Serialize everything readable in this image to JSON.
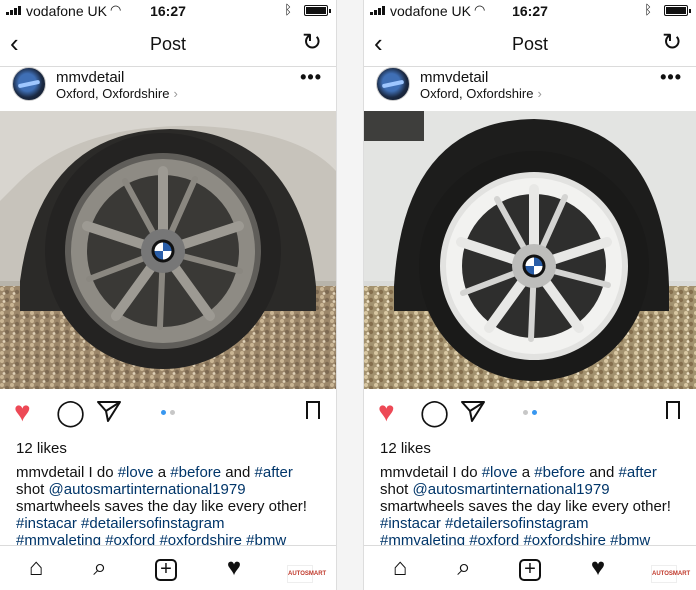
{
  "screens": [
    {
      "status": {
        "carrier": "vodafone UK",
        "time": "16:27"
      },
      "nav": {
        "title": "Post"
      },
      "post": {
        "username": "mmvdetail",
        "location": "Oxford, Oxfordshire",
        "likes": "12 likes",
        "caption_user": "mmvdetail",
        "caption_line1": " I do ",
        "tag_love": "#love",
        "caption_a": " a ",
        "tag_before": "#before",
        "caption_and": " and ",
        "tag_after": "#after",
        "caption_shot": "shot ",
        "mention": "@autosmartinternational1979",
        "caption_line3": "smartwheels saves the day like every other!",
        "tag_instacar": "#instacar",
        "tag_detailers": "#detailersofinstagram",
        "tag_mmvaleting": "#mmvaleting",
        "tag_oxford": "#oxford",
        "tag_oxfordshire": "#oxfordshire",
        "tag_bmw": "#bmw",
        "image": "dirty-wheel-before",
        "carousel_active": 0
      },
      "tabbar": {
        "profile_text": "AUTOSMART"
      }
    },
    {
      "status": {
        "carrier": "vodafone UK",
        "time": "16:27"
      },
      "nav": {
        "title": "Post"
      },
      "post": {
        "username": "mmvdetail",
        "location": "Oxford, Oxfordshire",
        "likes": "12 likes",
        "caption_user": "mmvdetail",
        "caption_line1": " I do ",
        "tag_love": "#love",
        "caption_a": " a ",
        "tag_before": "#before",
        "caption_and": " and ",
        "tag_after": "#after",
        "caption_shot": "shot ",
        "mention": "@autosmartinternational1979",
        "caption_line3": "smartwheels saves the day like every other!",
        "tag_instacar": "#instacar",
        "tag_detailers": "#detailersofinstagram",
        "tag_mmvaleting": "#mmvaleting",
        "tag_oxford": "#oxford",
        "tag_oxfordshire": "#oxfordshire",
        "tag_bmw": "#bmw",
        "image": "clean-wheel-after",
        "carousel_active": 1
      },
      "tabbar": {
        "profile_text": "AUTOSMART"
      }
    }
  ],
  "colors": {
    "like": "#ed4956",
    "hashtag": "#003569",
    "dot_active": "#3897f0"
  },
  "icons": [
    "signal-icon",
    "wifi-icon",
    "bluetooth-icon",
    "battery-icon",
    "back-chevron-icon",
    "refresh-icon",
    "more-icon",
    "heart-icon",
    "comment-icon",
    "share-icon",
    "bookmark-icon",
    "home-icon",
    "search-icon",
    "add-icon",
    "activity-heart-icon",
    "profile-icon"
  ]
}
